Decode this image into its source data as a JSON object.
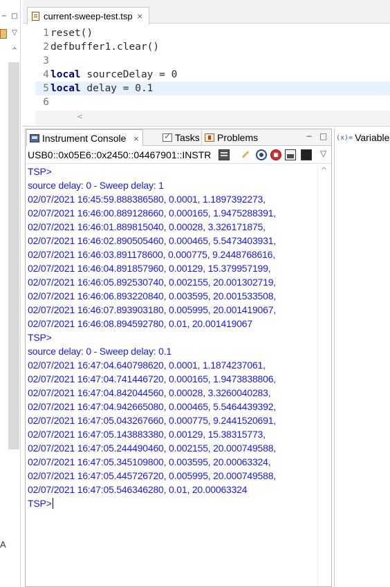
{
  "left_strip": {
    "letter": "A"
  },
  "editor": {
    "tab_title": "current-sweep-test.tsp",
    "lines": [
      {
        "num": "1",
        "kw": "",
        "text": "reset()"
      },
      {
        "num": "2",
        "kw": "",
        "text": "defbuffer1.clear()"
      },
      {
        "num": "3",
        "kw": "",
        "text": ""
      },
      {
        "num": "4",
        "kw": "local",
        "text": " sourceDelay = 0"
      },
      {
        "num": "5",
        "kw": "local",
        "text": " delay = 0.1"
      },
      {
        "num": "6",
        "kw": "",
        "text": ""
      }
    ]
  },
  "console": {
    "tabs": {
      "console": "Instrument Console",
      "tasks": "Tasks",
      "problems": "Problems"
    },
    "resource": "USB0::0x05E6::0x2450::04467901::INSTR",
    "output": [
      "TSP>",
      "source delay: 0 - Sweep delay: 1",
      "02/07/2021 16:45:59.888386580, 0.0001, 1.1897392273,",
      "02/07/2021 16:46:00.889128660, 0.000165, 1.9475288391,",
      "02/07/2021 16:46:01.889815040, 0.00028, 3.326171875,",
      "02/07/2021 16:46:02.890505460, 0.000465, 5.5473403931,",
      "02/07/2021 16:46:03.891178600, 0.000775, 9.2448768616,",
      "02/07/2021 16:46:04.891857960, 0.00129, 15.379957199,",
      "02/07/2021 16:46:05.892530740, 0.002155, 20.001302719,",
      "02/07/2021 16:46:06.893220840, 0.003595, 20.001533508,",
      "02/07/2021 16:46:07.893903180, 0.005995, 20.001419067,",
      "02/07/2021 16:46:08.894592780, 0.01, 20.001419067",
      "TSP>",
      "source delay: 0 - Sweep delay: 0.1",
      "02/07/2021 16:47:04.640798620, 0.0001, 1.1874237061,",
      "02/07/2021 16:47:04.741446720, 0.000165, 1.9473838806,",
      "02/07/2021 16:47:04.842044560, 0.00028, 3.3260040283,",
      "02/07/2021 16:47:04.942665080, 0.000465, 5.5464439392,",
      "02/07/2021 16:47:05.043267660, 0.000775, 9.2441520691,",
      "02/07/2021 16:47:05.143883380, 0.00129, 15.38315773,",
      "02/07/2021 16:47:05.244490460, 0.002155, 20.000749588,",
      "02/07/2021 16:47:05.345109800, 0.003595, 20.00063324,",
      "02/07/2021 16:47:05.445726720, 0.005995, 20.000749588,",
      "02/07/2021 16:47:05.546346280, 0.01, 20.00063324"
    ],
    "prompt": "TSP>"
  },
  "variables": {
    "label": "Variables",
    "icon_text": "(x)="
  },
  "colors": {
    "output_text": "#1a1ae6",
    "keyword": "#00007f",
    "highlight_line": "#e8f2fe"
  },
  "icons": {
    "close": "×",
    "minimize": "−",
    "maximize": "□",
    "menu": "▽",
    "up": "^",
    "left": "<"
  }
}
